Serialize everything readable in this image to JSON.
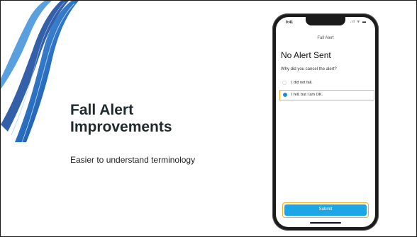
{
  "slide": {
    "headline_line1": "Fall Alert",
    "headline_line2": "Improvements",
    "subhead": "Easier to understand terminology"
  },
  "phone": {
    "status_time": "9:41",
    "status_icons": ".ıl ᯤ ▬",
    "nav_title": "Fall Alert",
    "screen_title": "No Alert Sent",
    "question": "Why did you cancel the alert?",
    "options": [
      {
        "label": "I did not fall.",
        "selected": false
      },
      {
        "label": "I fell, but I am OK.",
        "selected": true
      }
    ],
    "submit_label": "Submit"
  },
  "colors": {
    "highlight": "#f0b323",
    "accent": "#1ca6e6",
    "ribbon": "#2a6fc0"
  }
}
